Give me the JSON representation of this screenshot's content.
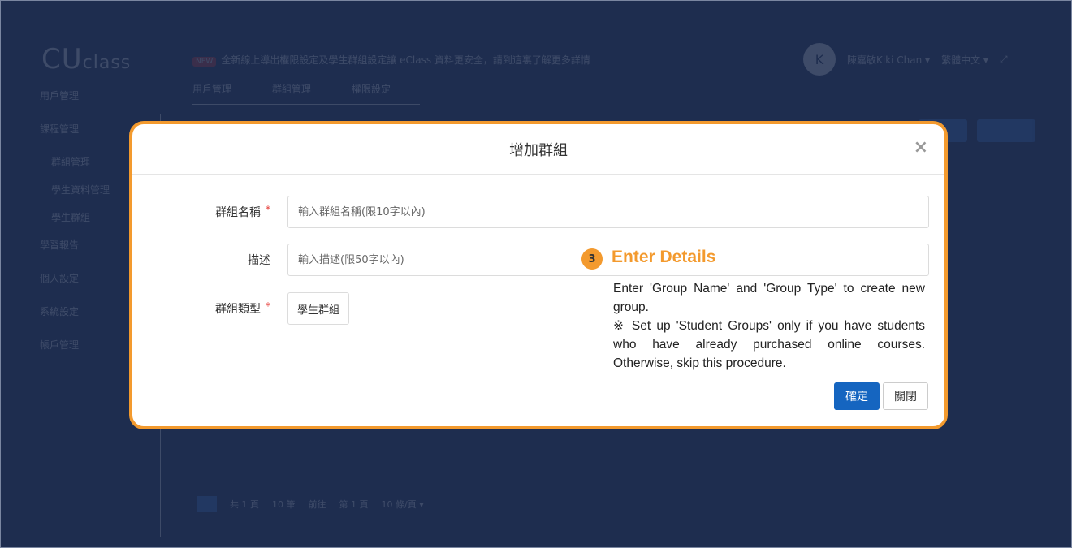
{
  "background": {
    "logo": "CU",
    "logo_suffix": "class",
    "user_initial": "K",
    "user_name": "陳嘉敏Kiki Chan ▾",
    "language": "繁體中文 ▾",
    "new_badge": "NEW",
    "notice": "全新線上導出權限設定及學生群組設定讓 eClass 資料更安全，請到這裏了解更多詳情",
    "tabs": [
      "用戶管理",
      "群組管理",
      "權限設定"
    ],
    "sidebar": [
      "用戶管理",
      "課程管理",
      "群組管理",
      "學生資料管理",
      "學生群組",
      "學習報告",
      "個人設定",
      "系統設定",
      "帳戶管理"
    ],
    "pager": [
      "1",
      "共 1 頁",
      "10 筆",
      "前往",
      "第 1 頁",
      "10 條/頁 ▾"
    ]
  },
  "modal": {
    "title": "增加群組",
    "close_symbol": "×",
    "fields": {
      "name_label": "群組名稱",
      "name_placeholder": "輸入群組名稱(限10字以內)",
      "desc_label": "描述",
      "desc_placeholder": "輸入描述(限50字以內)",
      "type_label": "群組類型",
      "type_value": "學生群組",
      "required_mark": "*"
    },
    "buttons": {
      "confirm": "確定",
      "close": "關閉"
    }
  },
  "annotation": {
    "step": "3",
    "title": "Enter Details",
    "line1": "Enter 'Group Name' and 'Group Type' to create new group.",
    "line2": "※ Set up 'Student Groups' only if you have students who have already purchased online courses. Otherwise, skip this procedure."
  },
  "colors": {
    "accent_orange": "#f39a2e",
    "primary_blue": "#1565c0",
    "overlay": "#1e2d4f"
  }
}
